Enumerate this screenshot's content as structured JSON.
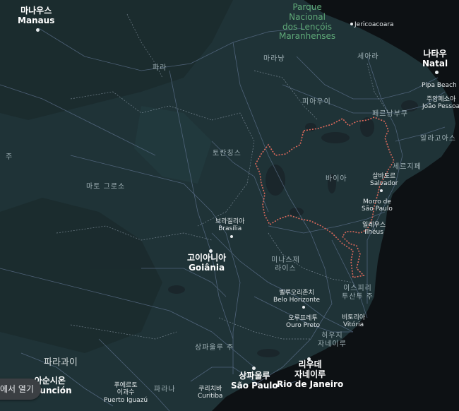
{
  "map": {
    "colors": {
      "land": "#1f3337",
      "ocean": "#0d1114",
      "border": "#e06a5c",
      "roads": "#6d7f9a"
    },
    "labels": {
      "manaus_ko": "마나우스",
      "manaus": "Manaus",
      "park_1": "Parque",
      "park_2": "Nacional",
      "park_3": "dos Lençóis",
      "park_4": "Maranhenses",
      "jericoacoara": "Jericoacoara",
      "natal_ko": "나타우",
      "natal": "Natal",
      "para": "파라",
      "maranhao": "마라냥",
      "ceara": "세아라",
      "piaui": "피아우이",
      "pipa": "Pipa Beach",
      "joaopessoa_ko": "주앙페소아",
      "joaopessoa": "João Pessoa",
      "pernambuco": "페르남부쿠",
      "alagoas": "알라고아스",
      "tocantins": "토칸칭스",
      "sergipe": "세르지페",
      "bahia": "바이아",
      "salvador_ko": "살바도르",
      "salvador": "Salvador",
      "matogrosso": "마토 그로소",
      "morro_1": "Morro de",
      "morro_2": "São Paulo",
      "brasilia_ko": "브라질리아",
      "brasilia": "Brasília",
      "ilheus_ko": "일레우스",
      "ilheus": "Ilhéus",
      "goiania_ko": "고이아니아",
      "goiania": "Goiânia",
      "minas_1": "미나스제",
      "minas_2": "라이스",
      "es_1": "이스피리",
      "es_2": "투산투 주",
      "bh_ko": "벨루오리존치",
      "bh": "Belo Horizonte",
      "ouropreto_ko": "오루프레투",
      "ouropreto": "Ouro Preto",
      "vitoria_ko": "비토리아",
      "vitoria": "Vitória",
      "rj_state_1": "히우지",
      "rj_state_2": "자네이루",
      "sp_state": "상파울루 주",
      "paraguay": "파라과이",
      "asuncion_ko": "아순시온",
      "asuncion": "Asunción",
      "foz_1": "푸에르토",
      "foz_2": "이과수",
      "foz": "Puerto Iguazú",
      "parana": "파라나",
      "curitiba_ko": "쿠리치바",
      "curitiba": "Curitiba",
      "sp_ko": "상파울루",
      "sp": "São Paulo",
      "rj_ko": "리우데",
      "rj_ko2": "자네이루",
      "rj": "Rio de Janeiro",
      "edge_state": "주"
    },
    "open_button": "에서 열기"
  }
}
